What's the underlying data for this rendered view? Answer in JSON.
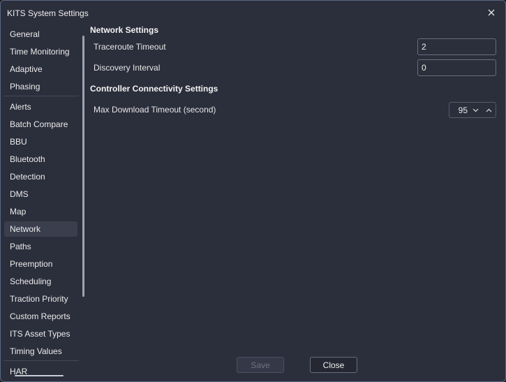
{
  "window": {
    "title": "KITS System Settings"
  },
  "icons": {
    "close": "close-icon",
    "down": "chevron-down-icon",
    "up": "chevron-up-icon"
  },
  "sidebar": {
    "selected": "Network",
    "items": [
      {
        "label": "General"
      },
      {
        "label": "Time Monitoring"
      },
      {
        "label": "Adaptive"
      },
      {
        "label": "Phasing"
      },
      {
        "label": "Alerts"
      },
      {
        "label": "Batch Compare"
      },
      {
        "label": "BBU"
      },
      {
        "label": "Bluetooth"
      },
      {
        "label": "Detection"
      },
      {
        "label": "DMS"
      },
      {
        "label": "Map"
      },
      {
        "label": "Network"
      },
      {
        "label": "Paths"
      },
      {
        "label": "Preemption"
      },
      {
        "label": "Scheduling"
      },
      {
        "label": "Traction Priority"
      },
      {
        "label": "Custom Reports"
      },
      {
        "label": "ITS Asset Types"
      },
      {
        "label": "Timing Values"
      },
      {
        "label": "HAR"
      }
    ]
  },
  "network": {
    "title": "Network Settings",
    "traceroute_label": "Traceroute Timeout",
    "traceroute_value": "2",
    "discovery_label": "Discovery Interval",
    "discovery_value": "0"
  },
  "controller": {
    "title": "Controller Connectivity Settings",
    "max_download_label": "Max Download Timeout (second)",
    "max_download_value": "95"
  },
  "footer": {
    "save_label": "Save",
    "close_label": "Close"
  }
}
